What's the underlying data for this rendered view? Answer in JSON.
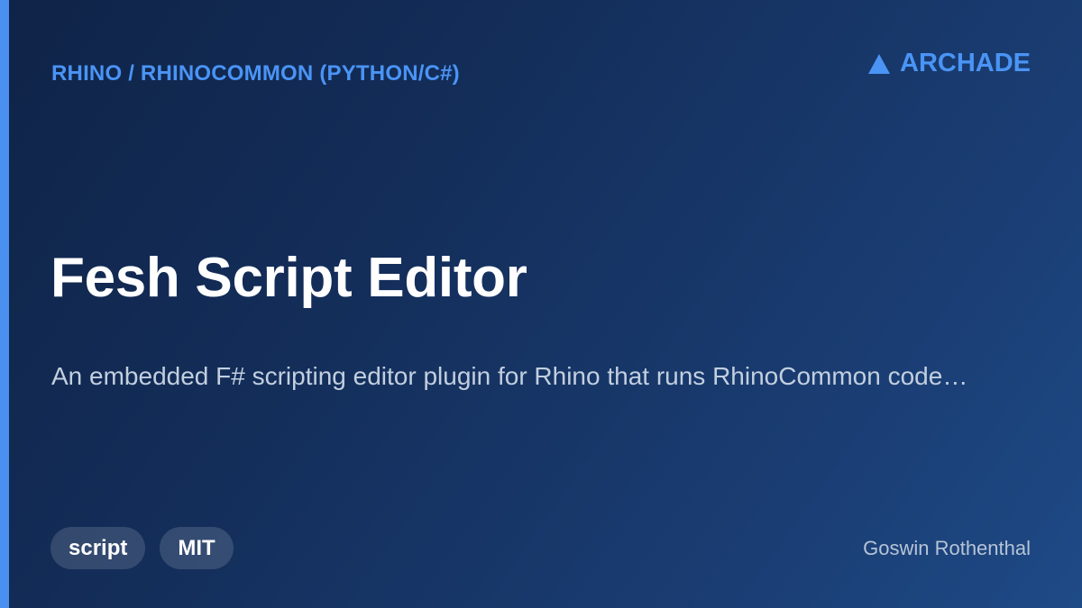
{
  "category": "RHINO / RHINOCOMMON (PYTHON/C#)",
  "brand": {
    "icon": "triangle-logo-icon",
    "name": "ARCHADE",
    "color": "#4a94f5"
  },
  "title": "Fesh Script Editor",
  "description": "An embedded F# scripting editor plugin for Rhino that runs RhinoCommon code…",
  "tags": [
    "script",
    "MIT"
  ],
  "author": "Goswin Rothenthal",
  "colors": {
    "accent": "#4a90f0",
    "background_start": "#0f2347",
    "background_end": "#1e4a86"
  }
}
